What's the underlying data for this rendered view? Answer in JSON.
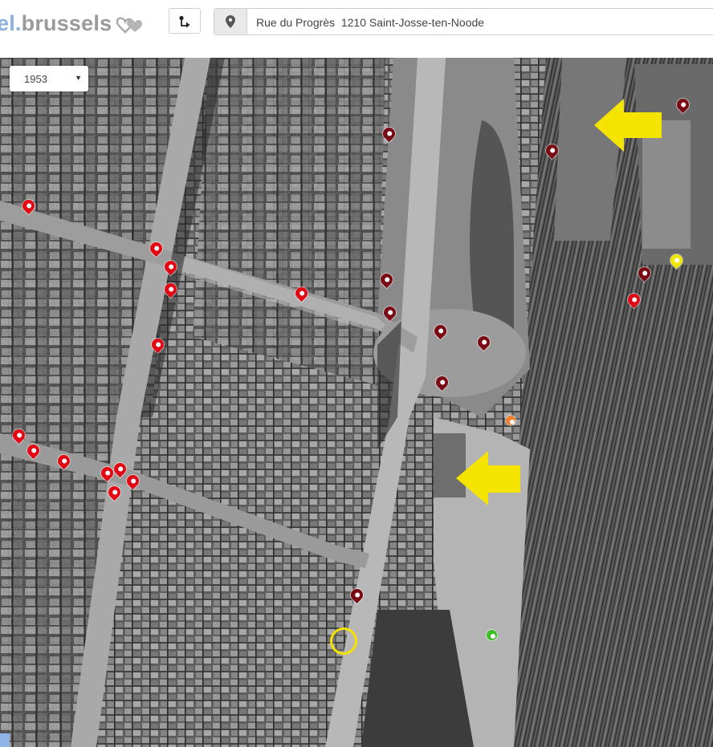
{
  "brand": {
    "prefix": "el",
    "dot": ".",
    "name": "brussels"
  },
  "search": {
    "address": "Rue du Progrès  1210 Saint-Josse-ten-Noode"
  },
  "year_select": {
    "value": "1953"
  },
  "icons": [
    "heart-logo-icon",
    "route-icon",
    "map-pin-icon",
    "caret-down-icon",
    "arrow-left-icon"
  ],
  "colors": {
    "marker_red": "#e30613",
    "marker_dark": "#7a0a14",
    "highlight": "#f5e400",
    "marker_orange": "#f08030",
    "marker_green": "#3fbf2a"
  }
}
